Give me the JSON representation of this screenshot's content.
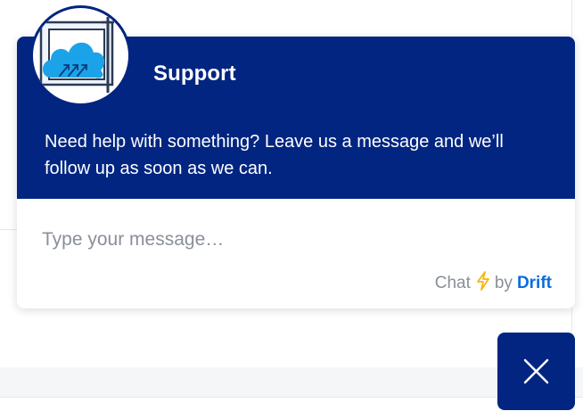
{
  "widget": {
    "title": "Support",
    "welcome_message": "Need help with something? Leave us a message and we’ll follow up as soon as we can.",
    "avatar_icon": "cloud-upload-icon",
    "input": {
      "placeholder": "Type your message…",
      "value": ""
    },
    "powered_by": {
      "prefix": "Chat",
      "bolt_icon": "lightning-bolt-icon",
      "by": "by",
      "brand": "Drift"
    }
  },
  "launcher": {
    "icon": "close-icon"
  },
  "colors": {
    "header_bg": "#012581",
    "brand_link": "#0c6cde",
    "bolt": "#f5b70f",
    "cloud": "#1aa3e8"
  }
}
